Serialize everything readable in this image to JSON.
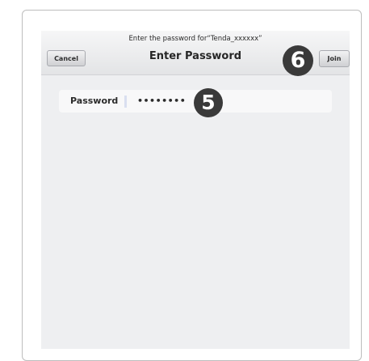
{
  "navbar": {
    "prompt": "Enter the password for“Tenda_xxxxxx”",
    "title": "Enter Password",
    "cancel_label": "Cancel",
    "join_label": "Join"
  },
  "password_field": {
    "label": "Password",
    "value": "••••••••"
  },
  "callouts": {
    "step_join": "6",
    "step_password": "5"
  }
}
